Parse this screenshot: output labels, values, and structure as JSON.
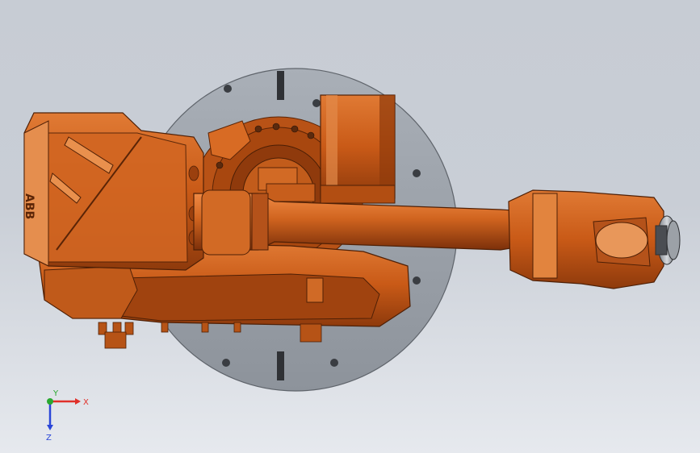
{
  "viewport": {
    "background_top": "#c7ccd4",
    "background_bottom": "#e6e9ee",
    "model_color": "#d9631e",
    "base_plate_color": "#9aa0a8"
  },
  "logo": {
    "text": "ABB"
  },
  "triad": {
    "x_label": "X",
    "y_label": "Y",
    "z_label": "Z",
    "x_color": "#e0302a",
    "y_color": "#2aa830",
    "z_color": "#2a46d8"
  }
}
